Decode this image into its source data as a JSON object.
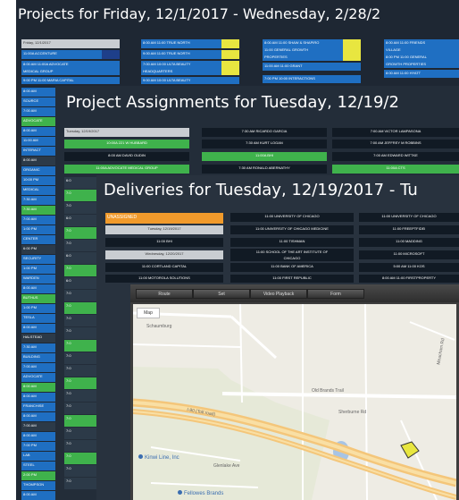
{
  "windows": {
    "projects": {
      "title": "Projects for Friday, 12/1/2017 - Wednesday, 2/28/2",
      "col1": [
        "Friday, 12/1/2017",
        "11:00A ACCENTURE",
        "8:00 AM 11:00A ADVOCATE",
        "MEDICAL GROUP",
        "9:00 PM 11:00 MARIA CAPITAL"
      ],
      "col2": [
        "8:00 AM 11:00 TRUE NORTH",
        "9:00 AM 11:00 TRUE NORTH",
        "7:00 AM 10:00 ULTA BEAUTY",
        "HEADQUARTERS",
        "9:00 AM 10:00 ULTA BEAUTY"
      ],
      "col3": [
        "8:00 AM 11:00 SHAW & SHAPIRO",
        "11:00 GENERAL GROWTH",
        "PROPERTIES",
        "11:00 AM 11:00 GRANT",
        "7:00 PM 10:00 INTERACTIONS"
      ],
      "col4": [
        "8:00 AM 11:00 FRIENDS",
        "VILLAGE",
        "8:00 PM 11:00 GENERAL",
        "GROWTH PROPERTIES",
        "8:00 AM 11:00 HYATT"
      ],
      "left_rows": [
        "8:00 AM",
        "SOURCE",
        "7:00 AM",
        "ADVOCATE",
        "8:00 AM",
        "11:00 AM",
        "INTERACT",
        "8:00 AM",
        "ORGANIC",
        "10:00 PM",
        "MEDICAL",
        "7:30 AM",
        "7:30 AM",
        "7:00 AM",
        "1:00 PM",
        "CENTER",
        "6:00 PM",
        "SECURITY",
        "1:00 PM",
        "WARDEN",
        "8:00 AM",
        "BUTHUS",
        "1:00 PM",
        "TESLA",
        "8:00 AM",
        "HALSTEAD",
        "7:30 AM",
        "BUILDING",
        "7:00 AM",
        "ADVOCATE",
        "8:00 AM",
        "8:00 AM",
        "FRANCHISE",
        "8:00 AM",
        "7:00 AM",
        "8:00 AM",
        "7:00 PM",
        "LAB",
        "STEEL",
        "2:00 PM",
        "THOMPSON",
        "8:00 AM"
      ]
    },
    "assignments": {
      "title": "Project Assignments for Tuesday, 12/19/2",
      "col1": [
        "Tuesday, 12/19/2017",
        "10:00A 221 W HUBBARD",
        "8:00 AM DAVID OUDIN",
        "11:00A ADVOCATE MEDICAL GROUP"
      ],
      "col2": [
        "7:30 AM RICARDO GARCIA",
        "7:30 AM KURT LOGAN",
        "11:00A BHI",
        "7:30 AM RONALD ABERNATHY"
      ],
      "col3": [
        "7:00 AM VICTOR LAMPASONA",
        "7:00 AM JEFFREY M ROBBINS",
        "7:00 AM EDWARD WITTKE",
        "11:00A CTS"
      ],
      "left_rows": [
        "6:0",
        "7:0",
        "7:0",
        "6:0",
        "7:0",
        "7:0",
        "6:0",
        "7:0",
        "6:0",
        "7:0",
        "7:0",
        "7:0",
        "7:0",
        "7:0",
        "7:0",
        "7:0",
        "7:0",
        "7:0",
        "7:0",
        "7:0",
        "7:0",
        "7:0",
        "7:0",
        "7:0",
        "7:0"
      ]
    },
    "deliveries": {
      "title": "Deliveries for Tuesday, 12/19/2017 - Tu",
      "unassigned": "UNASSIGNED",
      "col1": [
        "Tuesday, 12/19/2017",
        "11:00 BHI",
        "Wednesday, 12/20/2017",
        "11:00 CORTLAND CAPITAL",
        "11:00 MOTOROLA SOLUTIONS"
      ],
      "col2": [
        "11:00 UNIVERSITY OF CHICAGO",
        "11:00 UNIVERSITY OF CHICAGO MEDICINE",
        "11:00 TISHMAN",
        "11:00 SCHOOL OF THE ART INSTITUTE OF",
        "CHICAGO",
        "11:00 BANK OF AMERICA",
        "11:00 FIRST REPUBLIC"
      ],
      "col3": [
        "11:00 UNIVERSITY OF CHICAGO",
        "11:00 FREEPTFIDEI",
        "11:00 MADDING",
        "11:00 MICROSOFT",
        "5:00 AM 11:00 KOS",
        "8:00 AM 11:00 FIRSTPROPERTY"
      ]
    },
    "map": {
      "toolbar": [
        "Route",
        "Set",
        "Video Playback",
        "Form"
      ],
      "map_tab": "Map",
      "labels": {
        "road1": "Schaumburg",
        "road2": "Old Brands Trail",
        "road3": "Meacham Rd",
        "tollway": "I-90 (Toll road)",
        "street1": "Sherburne Rd",
        "street2": "Glenlake Ave",
        "poi1": "Kinwi Line, Inc",
        "poi2": "Fellowes Brands"
      }
    }
  },
  "colors": {
    "window_bg": "#1e2733",
    "cell_blue": "#1f6fc2",
    "cell_green": "#3fb24c",
    "cell_yellow": "#e8e640",
    "unassigned_orange": "#f19a2b"
  }
}
